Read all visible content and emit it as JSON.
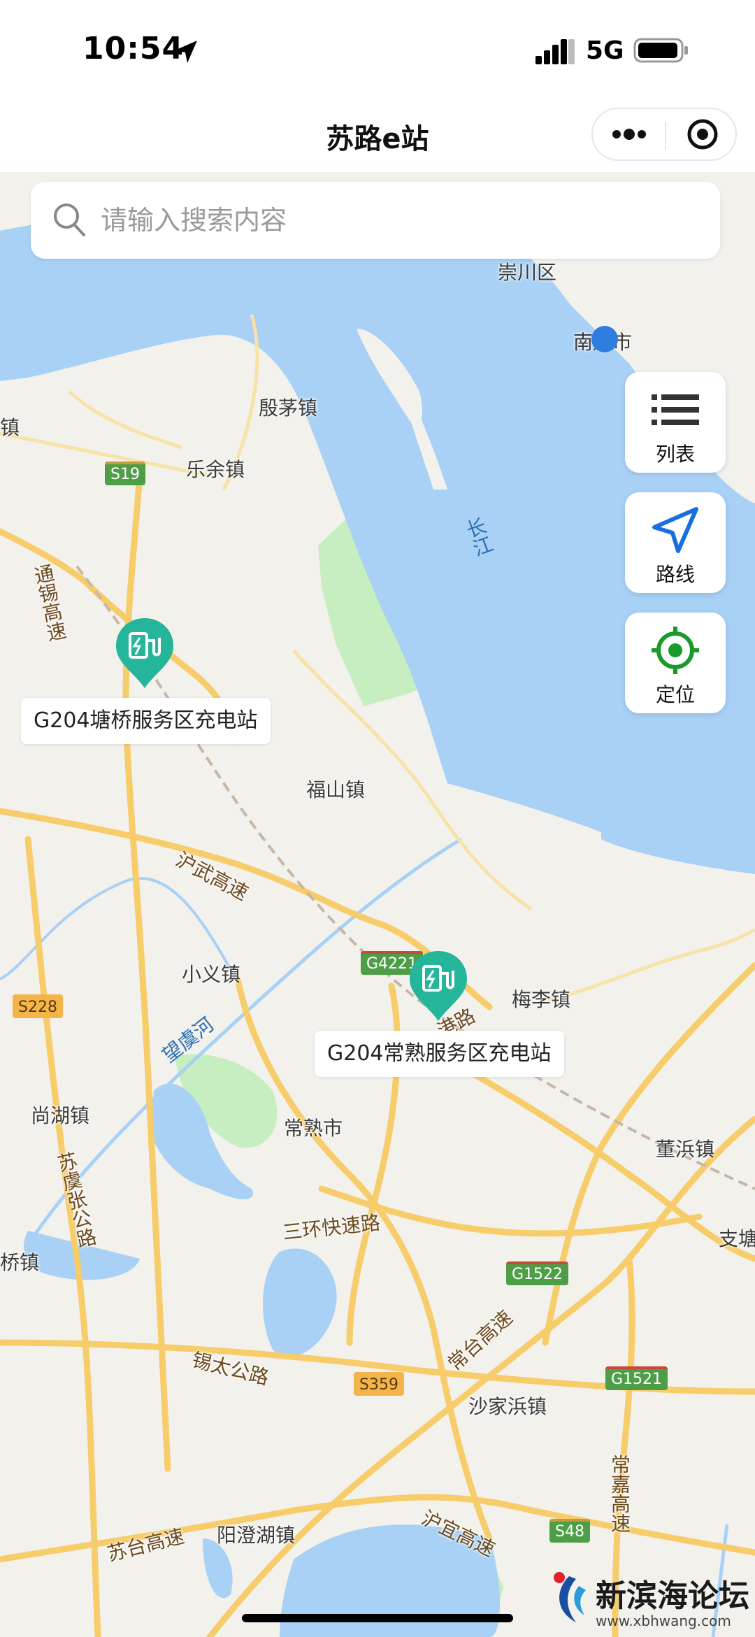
{
  "status_bar": {
    "time": "10:54",
    "network": "5G"
  },
  "nav": {
    "title": "苏路e站"
  },
  "search": {
    "placeholder": "请输入搜索内容"
  },
  "side_buttons": [
    {
      "label": "列表",
      "icon": "list-icon"
    },
    {
      "label": "路线",
      "icon": "navigate-arrow-icon"
    },
    {
      "label": "定位",
      "icon": "locate-icon"
    }
  ],
  "markers": [
    {
      "name": "G204塘桥服务区充电站",
      "icon": "charging-station-icon"
    },
    {
      "name": "G204常熟服务区充电站",
      "icon": "charging-station-icon"
    }
  ],
  "map": {
    "places": {
      "chongchuan": "崇川区",
      "nantong": "南通市",
      "yinmao": "殷茅镇",
      "zhen_left": "镇",
      "leyu": "乐余镇",
      "fushan": "福山镇",
      "xiaoyi": "小义镇",
      "meili": "梅李镇",
      "shanghu": "尚湖镇",
      "changshu": "常熟市",
      "dongbang": "董浜镇",
      "zhitang": "支塘",
      "qiao_left": "桥镇",
      "shajiabang": "沙家浜镇",
      "yangchenghu": "阳澄湖镇"
    },
    "roads": {
      "tongxi": "通锡高速",
      "huwu": "沪武高速",
      "sugang": "港路",
      "suyu": "苏虞张公路",
      "sanhuan": "三环快速路",
      "xitai": "锡太公路",
      "changtai": "常台高速",
      "sutai": "苏台高速",
      "huyi": "沪宜高速",
      "changjia": "常嘉高速"
    },
    "rivers": {
      "changjiang": "长江",
      "wangyu": "望虞河"
    },
    "shields": {
      "s19": "S19",
      "g4221": "G4221",
      "s228": "S228",
      "g1522": "G1522",
      "s359": "S359",
      "g1521": "G1521",
      "s48": "S48"
    }
  },
  "watermark": {
    "title": "新滨海论坛",
    "url": "www.xbhwang.com"
  },
  "colors": {
    "water": "#a8d1f5",
    "green": "#c6eec0",
    "road": "#f7cc6a",
    "marker": "#25b59a",
    "accent": "#1a6fe0",
    "locate": "#1a9a2a"
  }
}
